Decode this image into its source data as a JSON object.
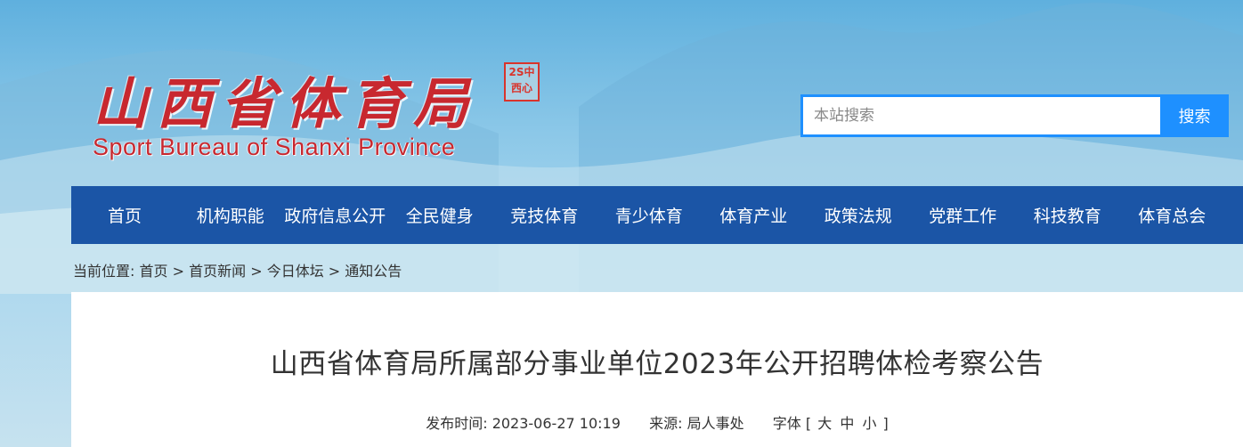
{
  "header": {
    "logo_cn": "山西省体育局",
    "logo_en": "Sport Bureau of Shanxi Province",
    "seal_text": "2S中西心"
  },
  "search": {
    "placeholder": "本站搜索",
    "button_label": "搜索"
  },
  "nav": {
    "items": [
      "首页",
      "机构职能",
      "政府信息公开",
      "全民健身",
      "竞技体育",
      "青少体育",
      "体育产业",
      "政策法规",
      "党群工作",
      "科技教育",
      "体育总会"
    ]
  },
  "breadcrumb": {
    "prefix": "当前位置:",
    "items": [
      "首页",
      "首页新闻",
      "今日体坛",
      "通知公告"
    ],
    "separator": " > "
  },
  "article": {
    "title": "山西省体育局所属部分事业单位2023年公开招聘体检考察公告",
    "publish_label": "发布时间:",
    "publish_time": "2023-06-27 10:19",
    "source_label": "来源:",
    "source": "局人事处",
    "font_label": "字体",
    "font_open": "[",
    "font_large": "大",
    "font_medium": "中",
    "font_small": "小",
    "font_close": "]"
  },
  "colors": {
    "nav_bg": "#1b55a6",
    "accent": "#1e90ff",
    "logo_red": "#c8282f"
  }
}
